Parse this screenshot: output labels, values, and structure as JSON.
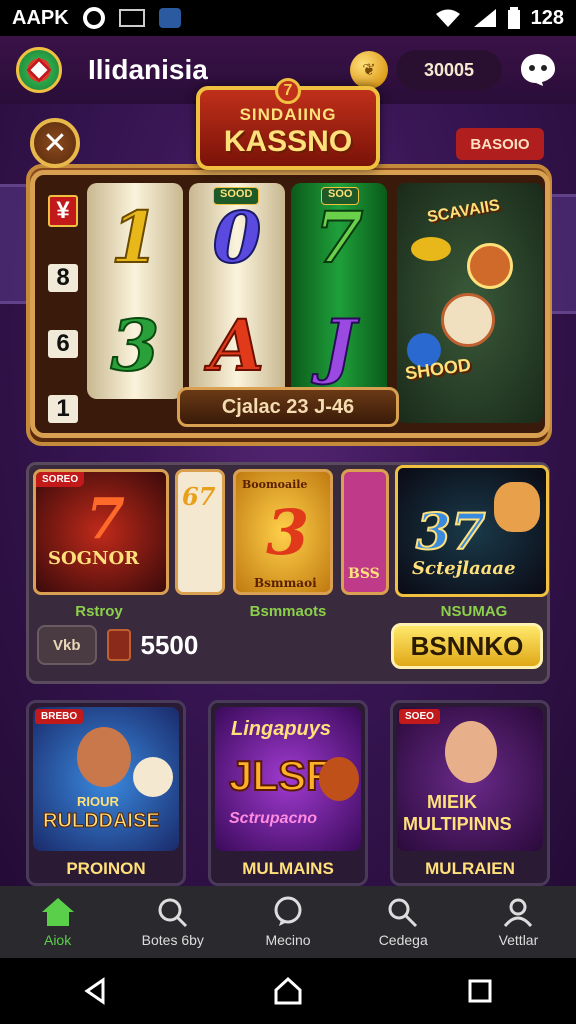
{
  "status_bar": {
    "app_label": "AAPK",
    "time": "128",
    "icons": [
      "circle-icon",
      "image-icon",
      "app-icon",
      "wifi-icon",
      "signal-icon",
      "battery-icon"
    ]
  },
  "header": {
    "title": "Ilidanisia",
    "balance": "30005",
    "icons": [
      "logo-icon",
      "coin-icon",
      "chat-icon"
    ]
  },
  "hero": {
    "banner_small": "SINDAIING",
    "banner_big": "KASSNO",
    "banner_badge": "7",
    "close_symbol": "✕",
    "tag_button": "BASOIO",
    "side_column": [
      "¥",
      "8",
      "6",
      "1"
    ],
    "reels": [
      {
        "tag": "",
        "top": "1",
        "bottom": "3"
      },
      {
        "tag": "SOOD",
        "top": "0",
        "bottom": "A"
      },
      {
        "tag": "SOO",
        "top": "7",
        "bottom": "J"
      }
    ],
    "promo_top": "SCAVAIIS",
    "promo_bottom": "SHOOD",
    "counter": "Cjalac 23 J-46"
  },
  "mid_panel": {
    "tiles": [
      {
        "tag": "SOREO",
        "big": "7",
        "label": "SOGNOR",
        "caption": "Rstroy"
      },
      {
        "tag": "",
        "big": "67",
        "label": "",
        "caption": ""
      },
      {
        "tag": "",
        "big": "3",
        "label": "Bsmmaoi",
        "caption": "Bsmmaots",
        "top": "Boomoaile"
      },
      {
        "tag": "",
        "big": "",
        "label": "BSS",
        "caption": ""
      },
      {
        "tag": "",
        "big": "37",
        "label": "Sctejlaaae",
        "caption": "NSUMAG"
      }
    ],
    "small_button": "Vkb",
    "bet_amount": "5500",
    "play_button": "BSNNKO"
  },
  "game_cards": [
    {
      "tag": "BREBO",
      "art_top": "RIOUR",
      "art_main": "RULDDAISE",
      "caption": "PROINON"
    },
    {
      "tag": "",
      "art_top": "Lingapuys",
      "art_main": "JLSR",
      "art_sub": "Sctrupacno",
      "caption": "MULMAINS"
    },
    {
      "tag": "SOEO",
      "art_top": "MIEIK",
      "art_main": "MULTIPINNS",
      "caption": "MULRAIEN"
    }
  ],
  "bottom_nav": [
    {
      "label": "Aiok",
      "icon": "home-icon",
      "active": true
    },
    {
      "label": "Botes 6by",
      "icon": "search-icon",
      "active": false
    },
    {
      "label": "Mecino",
      "icon": "chat-icon",
      "active": false
    },
    {
      "label": "Cedega",
      "icon": "search-icon",
      "active": false
    },
    {
      "label": "Vettlar",
      "icon": "user-icon",
      "active": false
    }
  ],
  "colors": {
    "accent_gold": "#f0c040",
    "active_green": "#5ad04a",
    "brand_purple": "#3a1656",
    "alert_red": "#c21a1a"
  }
}
